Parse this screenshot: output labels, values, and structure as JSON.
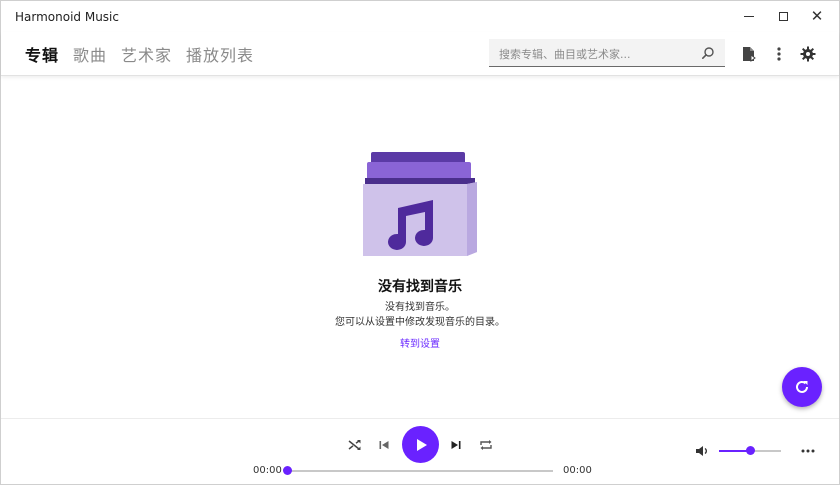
{
  "window": {
    "title": "Harmonoid Music",
    "minimize_icon": "minimize-icon",
    "maximize_icon": "maximize-icon",
    "close_icon": "close-icon"
  },
  "header": {
    "tabs": [
      {
        "label": "专辑",
        "active": true
      },
      {
        "label": "歌曲",
        "active": false
      },
      {
        "label": "艺术家",
        "active": false
      },
      {
        "label": "播放列表",
        "active": false
      }
    ],
    "search": {
      "placeholder": "搜索专辑、曲目或艺术家...",
      "value": "",
      "icon": "search-icon"
    },
    "icons": [
      "file-import-icon",
      "more-vert-icon",
      "gear-icon"
    ]
  },
  "empty_state": {
    "icon": "album-music-folder-icon",
    "title": "没有找到音乐",
    "line1": "没有找到音乐。",
    "line2": "您可以从设置中修改发现音乐的目录。",
    "link": "转到设置"
  },
  "fab": {
    "icon": "refresh-icon"
  },
  "player": {
    "current_time": "00:00",
    "duration": "00:00",
    "progress": 0,
    "volume": 0.5,
    "controls": [
      "shuffle-icon",
      "previous-icon",
      "play-icon",
      "next-icon",
      "repeat-icon"
    ],
    "volume_icon": "volume-icon",
    "more_icon": "more-horiz-icon"
  },
  "colors": {
    "accent": "#6a22ff",
    "illustration_light": "#cfc2ea",
    "illustration_mid": "#8a64d6",
    "illustration_dark": "#5b3aa6",
    "note": "#4f2a9c"
  }
}
